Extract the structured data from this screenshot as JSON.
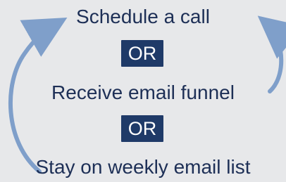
{
  "diagram": {
    "top_option": "Schedule a call",
    "middle_option": "Receive email funnel",
    "bottom_option": "Stay on weekly email list",
    "separator_1": "OR",
    "separator_2": "OR"
  },
  "colors": {
    "background": "#e7e8ea",
    "text": "#1d2f56",
    "separator_bg": "#1f3a68",
    "separator_text": "#ffffff",
    "arrow": "#7f9fca"
  }
}
